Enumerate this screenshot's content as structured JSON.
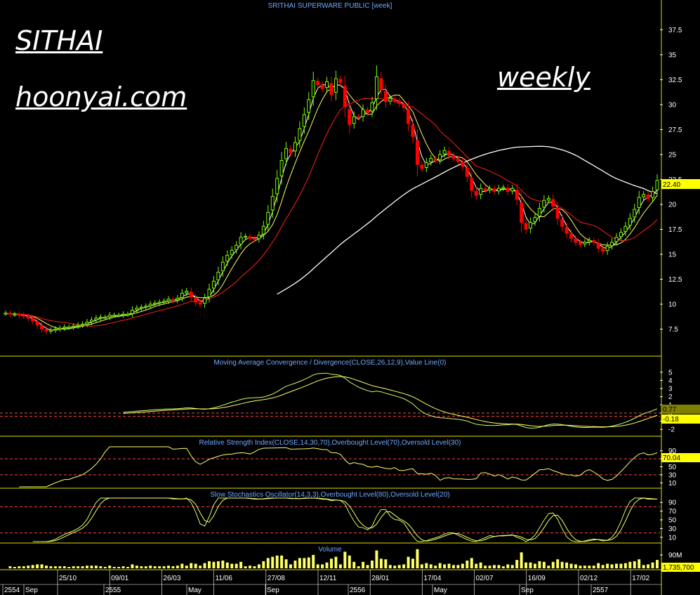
{
  "overlay": {
    "symbol_label": "SITHAI",
    "site_label": "hoonyai.com",
    "period_label": "weekly"
  },
  "colors": {
    "background": "#000000",
    "price_up": "#7CFC00",
    "price_down": "#FF0000",
    "ma_fast": "#FFFFFF",
    "ma_mid": "#FFFF66",
    "ma_slow": "#FF2020",
    "ma_long": "#FFFFFF",
    "indicator_line": "#CCFF66",
    "signal_line": "#FFFF66",
    "level_line": "#FF4444",
    "panel_title": "#6FA8FF",
    "panel_border": "#E0E000",
    "axis_text": "#FFFFFF",
    "value_box": "#FFFF00"
  },
  "chart_data": [
    {
      "type": "candlestick",
      "title": "SRITHAI SUPERWARE PUBLIC [week]",
      "y_ticks": [
        "37.5",
        "35",
        "32.5",
        "30",
        "27.5",
        "25",
        "22.5",
        "20",
        "17.5",
        "15",
        "12.5",
        "10",
        "7.5"
      ],
      "ylim": [
        5,
        39.5
      ],
      "last_value": "22.40",
      "close_series": [
        9.1,
        9.0,
        9.0,
        8.9,
        8.8,
        8.6,
        8.3,
        7.9,
        7.5,
        7.3,
        7.4,
        7.5,
        7.6,
        7.7,
        7.7,
        7.8,
        7.9,
        8.0,
        8.2,
        8.4,
        8.6,
        8.7,
        8.7,
        8.9,
        8.9,
        8.9,
        9.0,
        9.0,
        9.4,
        9.6,
        9.7,
        9.8,
        10.0,
        10.1,
        10.2,
        10.3,
        10.5,
        10.4,
        10.6,
        11.1,
        11.3,
        10.7,
        10.2,
        10.0,
        10.6,
        11.5,
        12.3,
        13.2,
        14.2,
        14.9,
        15.4,
        15.9,
        16.7,
        16.8,
        16.6,
        16.5,
        16.9,
        17.8,
        19.2,
        20.8,
        22.6,
        24.4,
        25.6,
        25.2,
        26.2,
        27.6,
        29.0,
        30.5,
        32.4,
        32.0,
        31.6,
        32.3,
        31.0,
        32.6,
        32.2,
        29.8,
        28.0,
        28.8,
        28.7,
        29.5,
        29.2,
        30.2,
        32.8,
        31.5,
        30.3,
        30.6,
        30.4,
        30.1,
        29.7,
        28.1,
        26.8,
        24.0,
        23.6,
        24.2,
        24.6,
        24.4,
        25.0,
        25.4,
        24.9,
        24.6,
        24.3,
        23.8,
        22.8,
        21.4,
        20.9,
        21.6,
        21.4,
        21.6,
        21.3,
        21.6,
        21.7,
        21.3,
        21.6,
        20.5,
        18.2,
        17.5,
        18.2,
        18.7,
        19.6,
        20.4,
        20.6,
        19.8,
        18.6,
        17.8,
        17.1,
        16.6,
        16.2,
        16.0,
        16.2,
        16.4,
        16.2,
        15.6,
        15.3,
        15.8,
        16.2,
        16.7,
        17.2,
        17.8,
        18.6,
        19.5,
        20.7,
        21.0,
        20.6,
        21.3,
        22.4
      ],
      "ma_fast_series": [
        9.1,
        9.05,
        9.03,
        9.0,
        8.96,
        8.9,
        8.8,
        8.67,
        8.49,
        8.3,
        8.1,
        7.9,
        7.75,
        7.66,
        7.6,
        7.62,
        7.7,
        7.78,
        7.9,
        8.04,
        8.18,
        8.3,
        8.42,
        8.54,
        8.66,
        8.74,
        8.82,
        8.88,
        9.0,
        9.14,
        9.26,
        9.38,
        9.5,
        9.66,
        9.82,
        9.96,
        10.1,
        10.2,
        10.3,
        10.5,
        10.62,
        10.6,
        10.56,
        10.48,
        10.54,
        10.7,
        10.96,
        11.38,
        11.96,
        12.7,
        13.5,
        14.3,
        15.1,
        15.7,
        16.02,
        16.3,
        16.55,
        16.96,
        17.6,
        18.5,
        19.6,
        20.8,
        22.0,
        23.0,
        24.0,
        25.0,
        26.0,
        27.1,
        28.3,
        29.3,
        30.0,
        30.7,
        31.1,
        31.5,
        31.7,
        31.5,
        31.0,
        30.6,
        30.2,
        30.0,
        29.7,
        29.6,
        30.0,
        30.2,
        30.3,
        30.4,
        30.4,
        30.3,
        30.1,
        29.5,
        28.8,
        27.7,
        26.6,
        25.8,
        25.3,
        24.9,
        24.6,
        24.6,
        24.7,
        24.7,
        24.6,
        24.4,
        24.1,
        23.6,
        23.1,
        22.6,
        22.3,
        22.0,
        21.7,
        21.6,
        21.6,
        21.5,
        21.5,
        21.2,
        20.6,
        19.9,
        19.4,
        19.1,
        19.0,
        19.2,
        19.4,
        19.5,
        19.4,
        19.1,
        18.6,
        18.0,
        17.4,
        16.9,
        16.6,
        16.4,
        16.3,
        16.1,
        15.9,
        15.8,
        15.8,
        15.9,
        16.1,
        16.4,
        16.8,
        17.4,
        18.0,
        18.7,
        19.4,
        19.9,
        20.4
      ]
    },
    {
      "type": "line",
      "title": "Moving Average Convergence / Divergence(CLOSE,26,12,9),Value Line(0)",
      "y_ticks": [
        "5",
        "4",
        "3",
        "2",
        "1",
        "0",
        "-1",
        "-2"
      ],
      "ylim": [
        -2.5,
        5.5
      ],
      "values_shown": [
        "0.77",
        "-0.18"
      ]
    },
    {
      "type": "line",
      "title": "Relative Strength Index(CLOSE,14,30,70),Overbought Level(70),Oversold Level(30)",
      "y_ticks": [
        "90",
        "70",
        "50",
        "30",
        "10"
      ],
      "ylim": [
        0,
        100
      ],
      "levels": [
        70,
        30
      ],
      "last_value": "70.04"
    },
    {
      "type": "line",
      "title": "Slow Stochastics Oscillator(14,3,3),Overbought Level(80),Oversold Level(20)",
      "y_ticks": [
        "90",
        "70",
        "50",
        "30",
        "10"
      ],
      "ylim": [
        0,
        100
      ],
      "levels": [
        80,
        20
      ]
    },
    {
      "type": "bar",
      "title": "Volume",
      "y_ticks": [
        "90M"
      ],
      "last_value": "1,735,700"
    }
  ],
  "x_axis": {
    "upper_labels": [
      "25/10",
      "09/01",
      "26/03",
      "11/06",
      "27/08",
      "12/11",
      "28/01",
      "17/04",
      "02/07",
      "16/09",
      "02/12",
      "17/02"
    ],
    "lower_labels": [
      "2554",
      "Sep",
      "2555",
      "May",
      "Sep",
      "2556",
      "May",
      "Sep",
      "2557"
    ]
  }
}
